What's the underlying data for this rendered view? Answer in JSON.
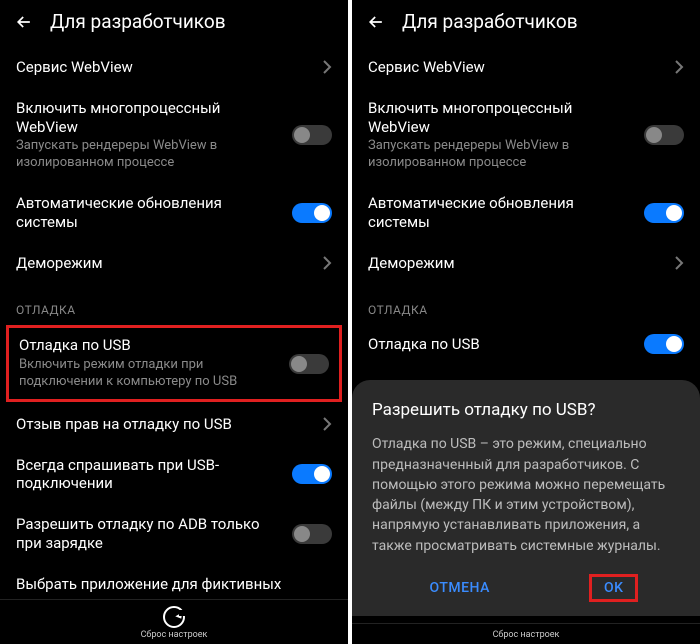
{
  "header": {
    "title": "Для разработчиков"
  },
  "rows": {
    "webview": {
      "title": "Сервис WebView"
    },
    "multiproc": {
      "title": "Включить многопроцессный WebView",
      "subtitle": "Запускать рендереры WebView в изолированном процессе"
    },
    "autoupdate": {
      "title": "Автоматические обновления системы"
    },
    "demomode": {
      "title": "Деморежим"
    },
    "section_debug": "ОТЛАДКА",
    "usbdebug": {
      "title": "Отладка по USB",
      "subtitle": "Включить режим отладки при подключении к компьютеру по USB"
    },
    "revoke": {
      "title": "Отзыв прав на отладку по USB"
    },
    "always_ask": {
      "title": "Всегда спрашивать при USB-подключении"
    },
    "adb_charge": {
      "title": "Разрешить отладку по ADВ только при зарядке"
    },
    "mock_app": {
      "title": "Выбрать приложение для фиктивных"
    }
  },
  "dialog": {
    "title": "Разрешить отладку по USB?",
    "body": "Отладка по USB – это режим, специально предназначенный для разработчиков. С помощью этого режима можно перемещать файлы (между ПК и этим устройством), напрямую устанавливать приложения, а также просматривать системные журналы.",
    "cancel": "ОТМЕНА",
    "ok": "OK"
  },
  "bottom": {
    "reset": "Сброс настроек"
  }
}
